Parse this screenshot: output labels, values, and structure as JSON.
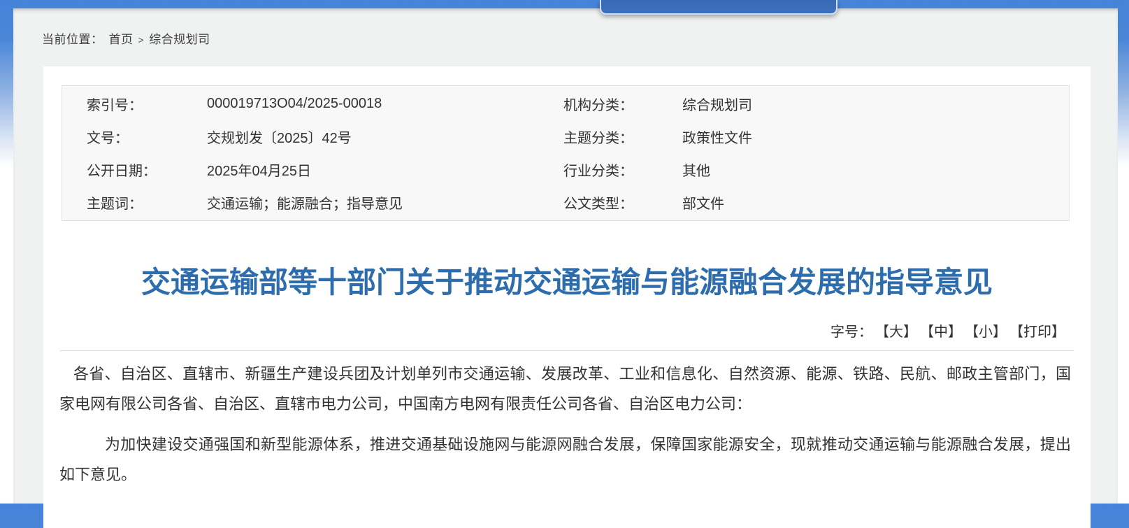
{
  "breadcrumb": {
    "label": "当前位置：",
    "home": "首页",
    "separator": ">",
    "section": "综合规划司"
  },
  "meta": {
    "rows": [
      {
        "l_label": "索引号：",
        "l_value": "000019713O04/2025-00018",
        "r_label": "机构分类：",
        "r_value": "综合规划司"
      },
      {
        "l_label": "文号：",
        "l_value": "交规划发〔2025〕42号",
        "r_label": "主题分类：",
        "r_value": "政策性文件"
      },
      {
        "l_label": "公开日期：",
        "l_value": "2025年04月25日",
        "r_label": "行业分类：",
        "r_value": "其他"
      },
      {
        "l_label": "主题词：",
        "l_value": "交通运输；能源融合；指导意见",
        "r_label": "公文类型：",
        "r_value": "部文件"
      }
    ]
  },
  "article": {
    "title": "交通运输部等十部门关于推动交通运输与能源融合发展的指导意见",
    "font_size_label": "字号：",
    "font_controls": [
      {
        "label": "【大】"
      },
      {
        "label": "【中】"
      },
      {
        "label": "【小】"
      },
      {
        "label": "【打印】"
      }
    ],
    "paragraphs": [
      "各省、自治区、直辖市、新疆生产建设兵团及计划单列市交通运输、发展改革、工业和信息化、自然资源、能源、铁路、民航、邮政主管部门，国家电网有限公司各省、自治区、直辖市电力公司，中国南方电网有限责任公司各省、自治区电力公司：",
      "为加快建设交通强国和新型能源体系，推进交通基础设施网与能源网融合发展，保障国家能源安全，现就推动交通运输与能源融合发展，提出如下意见。"
    ]
  },
  "colors": {
    "top_bar_blue": "#4a86d8",
    "tab_blue": "#3d6fbc",
    "title_blue": "#2e6dad",
    "page_gray": "#f0f1f1"
  }
}
